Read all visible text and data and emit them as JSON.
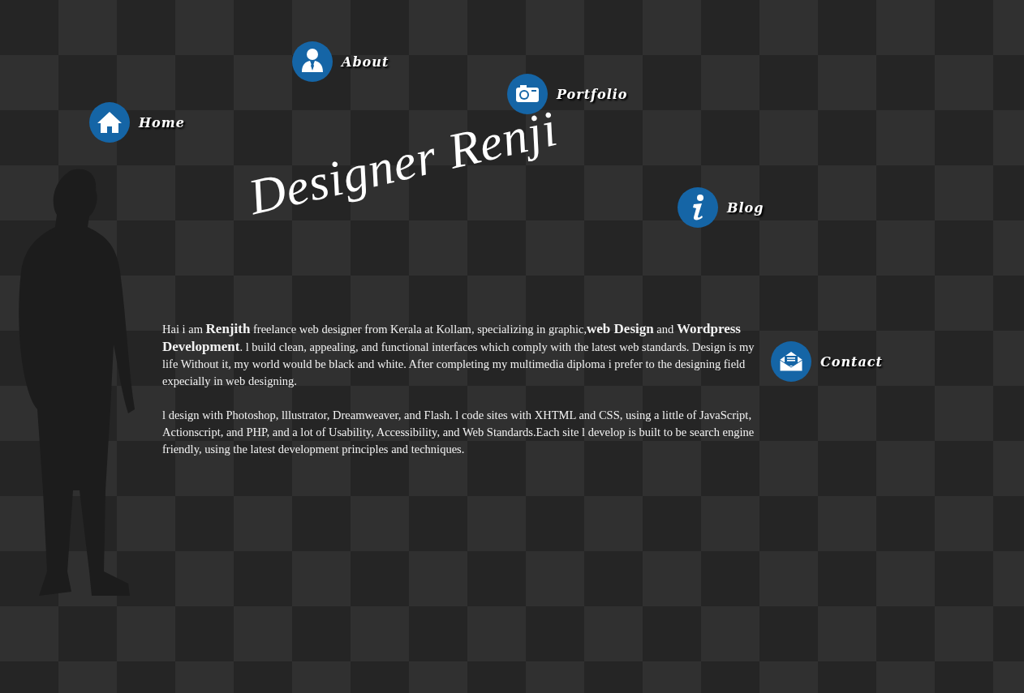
{
  "nav": [
    {
      "label": "About",
      "kind": "user"
    },
    {
      "label": "Portfolio",
      "kind": "camera"
    },
    {
      "label": "Home",
      "kind": "home"
    },
    {
      "label": "Blog",
      "kind": "info"
    },
    {
      "label": "Contact",
      "kind": "mail"
    }
  ],
  "logo": "Designer Renji",
  "intro": [
    "Hai i am **Renjith** freelance web designer from Kerala at Kollam, specializing in graphic,**web Design** and **Wordpress Development**. l build clean, appealing, and functional interfaces which comply with the latest web standards. Design is my life Without it, my world would be black and white. After completing my multimedia diploma i prefer to the designing field expecially in web designing.",
    "l design with Photoshop, lllustrator, Dreamweaver, and Flash. l code sites with XHTML and CSS, using a little of JavaScript, Actionscript, and PHP, and a lot of Usability, Accessibility, and Web Standards.Each site l develop is built to be search engine friendly, using the latest development principles and techniques."
  ]
}
